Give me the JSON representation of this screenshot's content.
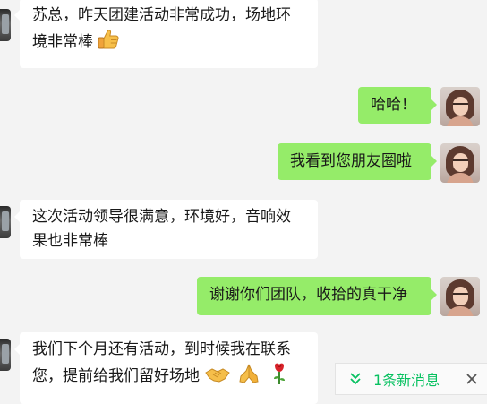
{
  "colors": {
    "background": "#f3f3f3",
    "bubble_left": "#ffffff",
    "bubble_right": "#95ec69",
    "accent_green": "#07c160"
  },
  "messages": [
    {
      "side": "left",
      "line1": "苏总，昨天团建活动非常成功，场地环",
      "line2": "境非常棒",
      "emoji_icon": "thumbs-up-icon"
    },
    {
      "side": "right",
      "text": "哈哈！"
    },
    {
      "side": "right",
      "text": "我看到您朋友圈啦"
    },
    {
      "side": "left",
      "line1": "这次活动领导很满意，环境好，音响效",
      "line2": "果也非常棒"
    },
    {
      "side": "right",
      "text": "谢谢你们团队，收拾的真干净"
    },
    {
      "side": "left",
      "line1": "我们下个月还有活动，到时候我在联系",
      "line2": "您，提前给我们留好场地",
      "emoji_icons": [
        "handshake-icon",
        "folded-hands-icon",
        "rose-icon"
      ]
    }
  ],
  "new_message_bar": {
    "icon": "double-chevron-down-icon",
    "label": "1条新消息",
    "close_icon": "close-icon"
  }
}
